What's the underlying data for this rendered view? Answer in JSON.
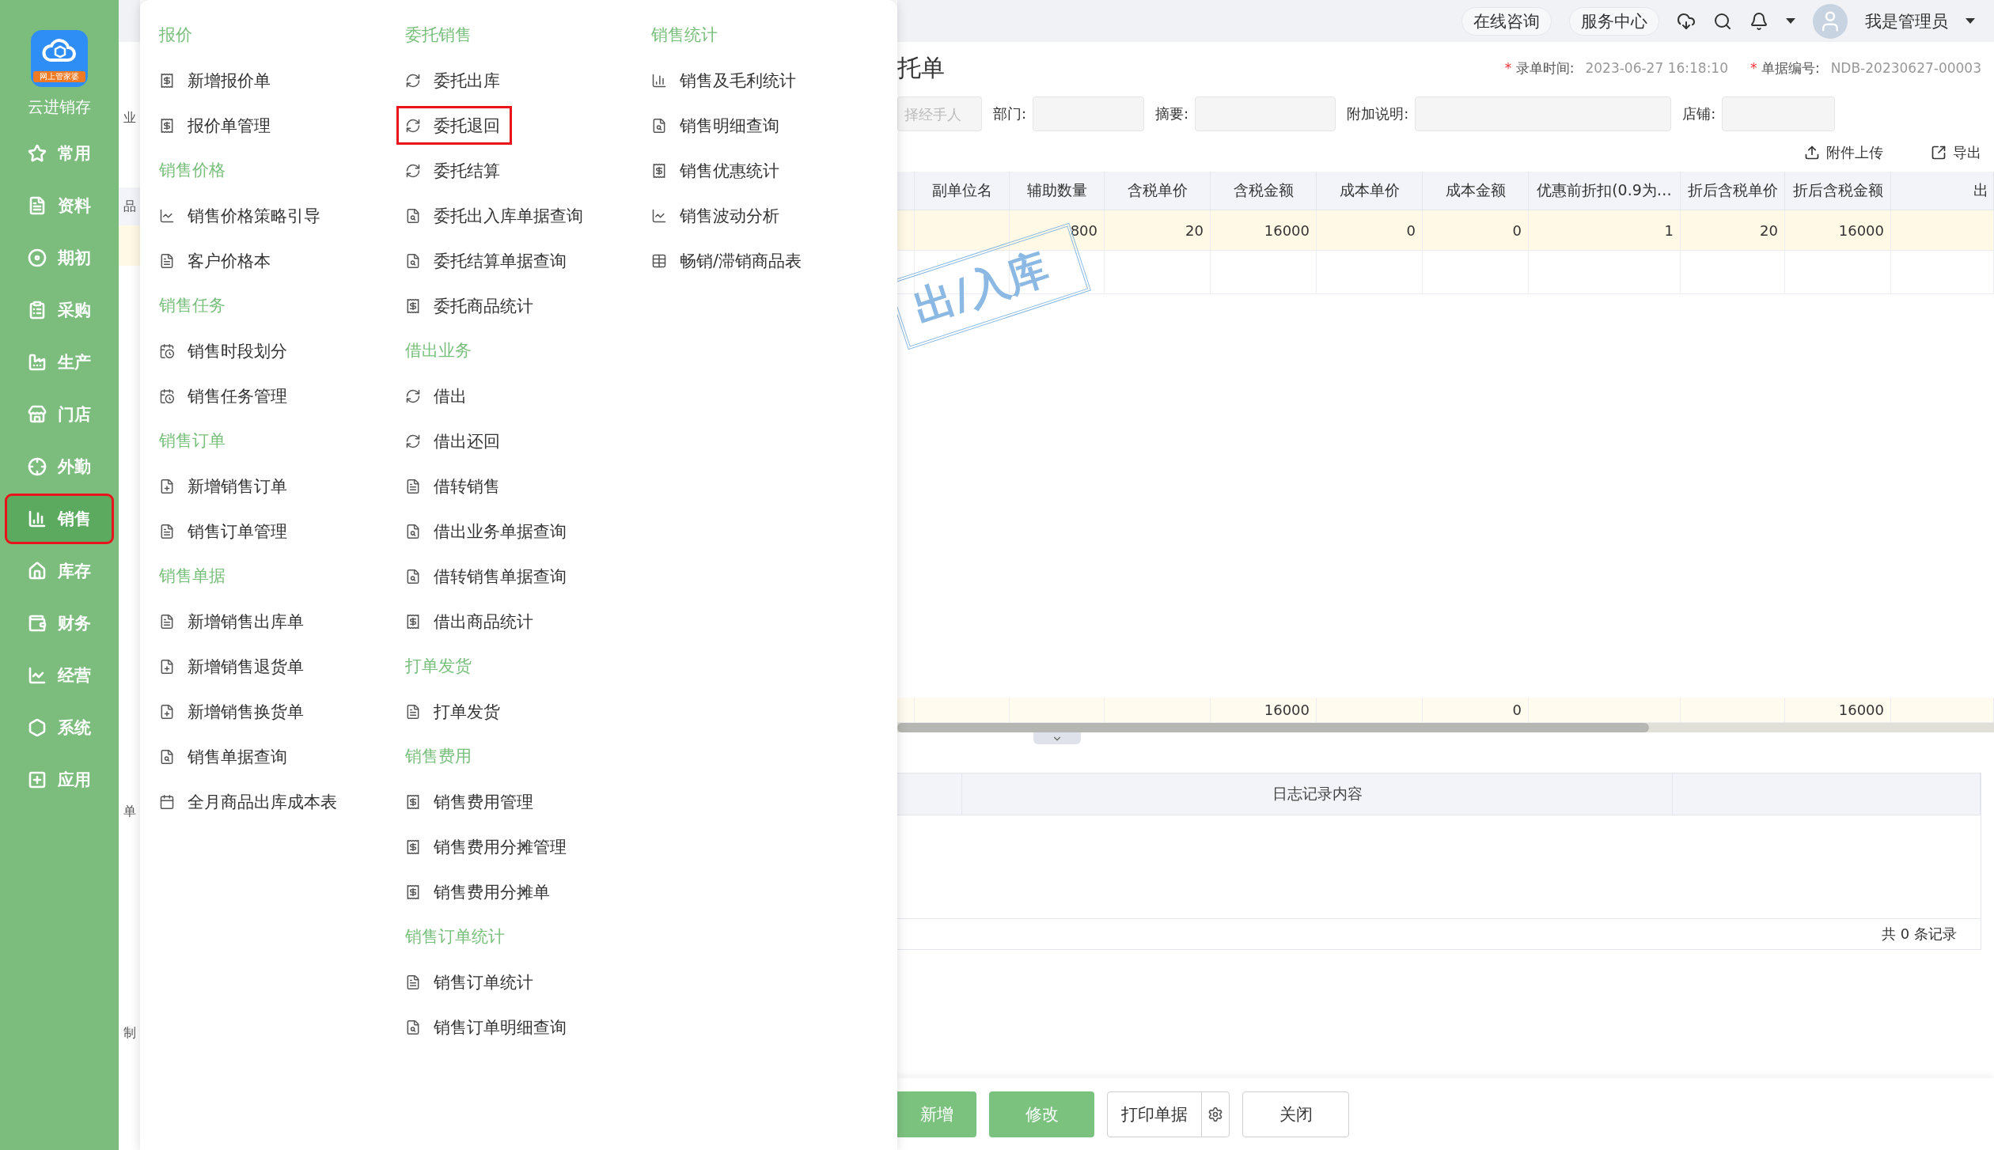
{
  "sidebar": {
    "logo_badge": "网上管家婆",
    "app_name": "云进销存",
    "items": [
      {
        "label": "常用",
        "selected": false
      },
      {
        "label": "资料",
        "selected": false
      },
      {
        "label": "期初",
        "selected": false
      },
      {
        "label": "采购",
        "selected": false
      },
      {
        "label": "生产",
        "selected": false
      },
      {
        "label": "门店",
        "selected": false
      },
      {
        "label": "外勤",
        "selected": false
      },
      {
        "label": "销售",
        "selected": true
      },
      {
        "label": "库存",
        "selected": false
      },
      {
        "label": "财务",
        "selected": false
      },
      {
        "label": "经营",
        "selected": false
      },
      {
        "label": "系统",
        "selected": false
      },
      {
        "label": "应用",
        "selected": false
      }
    ]
  },
  "menu": {
    "columns": [
      {
        "groups": [
          {
            "title": "报价",
            "items": [
              {
                "label": "新增报价单",
                "selected": false
              },
              {
                "label": "报价单管理",
                "selected": false
              }
            ]
          },
          {
            "title": "销售价格",
            "items": [
              {
                "label": "销售价格策略引导",
                "selected": false
              },
              {
                "label": "客户价格本",
                "selected": false
              }
            ]
          },
          {
            "title": "销售任务",
            "items": [
              {
                "label": "销售时段划分",
                "selected": false
              },
              {
                "label": "销售任务管理",
                "selected": false
              }
            ]
          },
          {
            "title": "销售订单",
            "items": [
              {
                "label": "新增销售订单",
                "selected": false
              },
              {
                "label": "销售订单管理",
                "selected": false
              }
            ]
          },
          {
            "title": "销售单据",
            "items": [
              {
                "label": "新增销售出库单",
                "selected": false
              },
              {
                "label": "新增销售退货单",
                "selected": false
              },
              {
                "label": "新增销售换货单",
                "selected": false
              },
              {
                "label": "销售单据查询",
                "selected": false
              },
              {
                "label": "全月商品出库成本表",
                "selected": false
              }
            ]
          }
        ]
      },
      {
        "groups": [
          {
            "title": "委托销售",
            "items": [
              {
                "label": "委托出库",
                "selected": false
              },
              {
                "label": "委托退回",
                "selected": true
              },
              {
                "label": "委托结算",
                "selected": false
              },
              {
                "label": "委托出入库单据查询",
                "selected": false
              },
              {
                "label": "委托结算单据查询",
                "selected": false
              },
              {
                "label": "委托商品统计",
                "selected": false
              }
            ]
          },
          {
            "title": "借出业务",
            "items": [
              {
                "label": "借出",
                "selected": false
              },
              {
                "label": "借出还回",
                "selected": false
              },
              {
                "label": "借转销售",
                "selected": false
              },
              {
                "label": "借出业务单据查询",
                "selected": false
              },
              {
                "label": "借转销售单据查询",
                "selected": false
              },
              {
                "label": "借出商品统计",
                "selected": false
              }
            ]
          },
          {
            "title": "打单发货",
            "items": [
              {
                "label": "打单发货",
                "selected": false
              }
            ]
          },
          {
            "title": "销售费用",
            "items": [
              {
                "label": "销售费用管理",
                "selected": false
              },
              {
                "label": "销售费用分摊管理",
                "selected": false
              },
              {
                "label": "销售费用分摊单",
                "selected": false
              }
            ]
          },
          {
            "title": "销售订单统计",
            "items": [
              {
                "label": "销售订单统计",
                "selected": false
              },
              {
                "label": "销售订单明细查询",
                "selected": false
              }
            ]
          }
        ]
      },
      {
        "groups": [
          {
            "title": "销售统计",
            "items": [
              {
                "label": "销售及毛利统计",
                "selected": false
              },
              {
                "label": "销售明细查询",
                "selected": false
              },
              {
                "label": "销售优惠统计",
                "selected": false
              },
              {
                "label": "销售波动分析",
                "selected": false
              },
              {
                "label": "畅销/滞销商品表",
                "selected": false
              }
            ]
          }
        ]
      }
    ]
  },
  "background_fragments": [
    "业",
    "品",
    "单",
    "制"
  ],
  "header": {
    "buttons": [
      "在线咨询",
      "服务中心"
    ],
    "user": "我是管理员"
  },
  "form": {
    "title": "托单",
    "record_time": {
      "required_mark": "*",
      "label": "录单时间:",
      "value": "2023-06-27 16:18:10"
    },
    "doc_no": {
      "required_mark": "*",
      "label": "单据编号:",
      "value": "NDB-20230627-00003"
    },
    "fields": [
      {
        "placeholder": "择经手人"
      },
      {
        "label": "部门:"
      },
      {
        "label": "摘要:"
      },
      {
        "label": "附加说明:"
      },
      {
        "label": "店铺:"
      }
    ]
  },
  "toolbar": [
    {
      "kind": "upload",
      "label": "附件上传"
    },
    {
      "kind": "export",
      "label": "导出"
    }
  ],
  "table": {
    "columns": [
      {
        "label": "副单位名"
      },
      {
        "label": "辅助数量"
      },
      {
        "label": "含税单价"
      },
      {
        "label": "含税金额",
        "total": "16000"
      },
      {
        "label": "成本单价"
      },
      {
        "label": "成本金额",
        "total": "0"
      },
      {
        "label": "优惠前折扣(0.9为…"
      },
      {
        "label": "折后含税单价"
      },
      {
        "label": "折后含税金额",
        "total": "16000"
      },
      {
        "label": "出"
      }
    ],
    "rows": [
      [
        null,
        "800",
        "20",
        "16000",
        "0",
        "0",
        "1",
        "20",
        "16000",
        null
      ]
    ]
  },
  "stamp": "出/入库",
  "log_table": {
    "heading": "日志记录内容",
    "footer": "共 0 条记录"
  },
  "actions": [
    {
      "kind": "primary",
      "label": "新增"
    },
    {
      "kind": "primary",
      "label": "修改"
    },
    {
      "kind": "split",
      "label": "打印单据"
    },
    {
      "kind": "plain",
      "label": "关闭"
    }
  ]
}
